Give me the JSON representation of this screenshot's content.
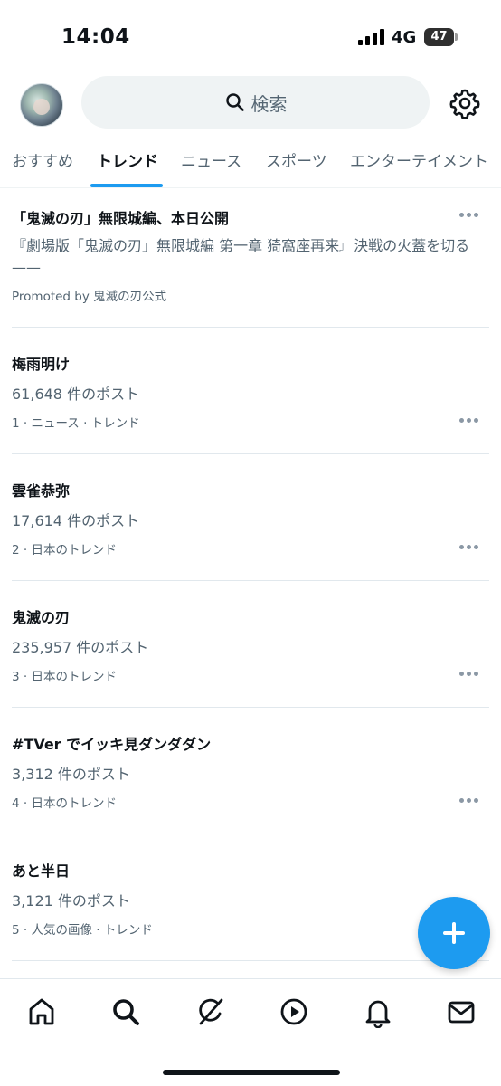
{
  "status_bar": {
    "time": "14:04",
    "network": "4G",
    "battery": "47"
  },
  "header": {
    "search_placeholder": "検索",
    "avatar_icon": "avatar",
    "settings_icon": "gear-icon"
  },
  "tabs": [
    {
      "label": "おすすめ",
      "active": false
    },
    {
      "label": "トレンド",
      "active": true
    },
    {
      "label": "ニュース",
      "active": false
    },
    {
      "label": "スポーツ",
      "active": false
    },
    {
      "label": "エンターテイメント",
      "active": false
    }
  ],
  "promoted": {
    "title": "「鬼滅の刃」無限城編、本日公開",
    "description": "『劇場版「鬼滅の刃」無限城編 第一章 猗窩座再来』決戦の火蓋を切る——",
    "promoted_by": "Promoted by 鬼滅の刃公式"
  },
  "trends": [
    {
      "title": "梅雨明け",
      "count": "61,648 件のポスト",
      "meta": "1 · ニュース · トレンド"
    },
    {
      "title": "雲雀恭弥",
      "count": "17,614 件のポスト",
      "meta": "2 · 日本のトレンド"
    },
    {
      "title": "鬼滅の刃",
      "count": "235,957 件のポスト",
      "meta": "3 · 日本のトレンド"
    },
    {
      "title": "#TVer でイッキ見ダンダダン",
      "count": "3,312 件のポスト",
      "meta": "4 · 日本のトレンド"
    },
    {
      "title": "あと半日",
      "count": "3,121 件のポスト",
      "meta": "5 · 人気の画像 · トレンド"
    }
  ],
  "bottom_nav": [
    "home-icon",
    "search-icon",
    "grok-icon",
    "video-icon",
    "bell-icon",
    "mail-icon"
  ],
  "fab": {
    "icon": "plus-icon"
  },
  "colors": {
    "accent": "#1d9bf0",
    "text_primary": "#0f1419",
    "text_secondary": "#536471"
  }
}
